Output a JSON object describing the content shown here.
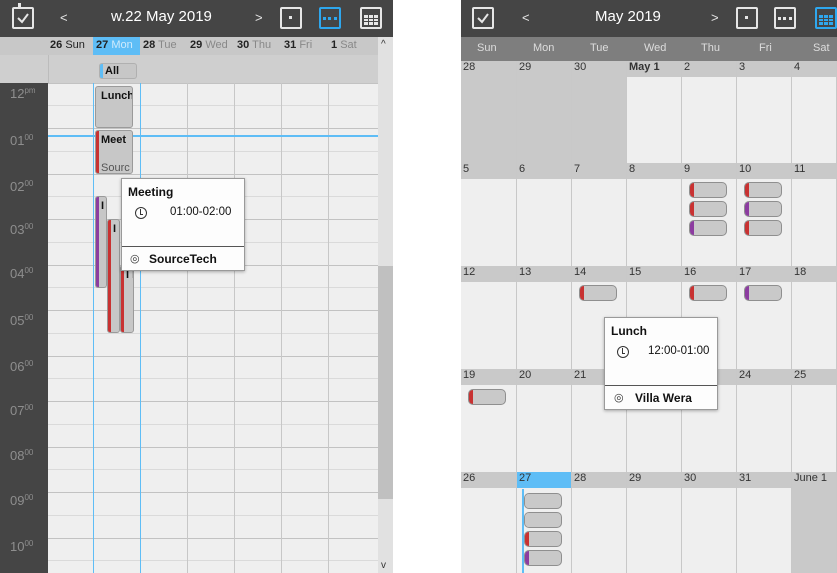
{
  "week_view": {
    "title": "w.22 May 2019",
    "prev": "<",
    "next": ">",
    "days": [
      {
        "num": "26",
        "name": "Sun"
      },
      {
        "num": "27",
        "name": "Mon"
      },
      {
        "num": "28",
        "name": "Tue"
      },
      {
        "num": "29",
        "name": "Wed"
      },
      {
        "num": "30",
        "name": "Thu"
      },
      {
        "num": "31",
        "name": "Fri"
      },
      {
        "num": "1",
        "name": "Sat"
      }
    ],
    "allday_label": "All",
    "times": [
      "12pm",
      "01",
      "02",
      "03",
      "04",
      "05",
      "06",
      "07",
      "08",
      "09",
      "10"
    ],
    "time_suffix": "00",
    "time_pm": "pm",
    "events": {
      "lunch": "Lunch",
      "meeting": "Meet",
      "source": "Sourc",
      "short1": "I",
      "short2": "I ,",
      "short3": "I I"
    },
    "popup": {
      "title": "Meeting",
      "time": "01:00-02:00",
      "location": "SourceTech"
    },
    "colors": {
      "red": "#c83232",
      "purple": "#8c3ca0",
      "blue": "#5ebdf6"
    }
  },
  "month_view": {
    "title": "May 2019",
    "prev": "<",
    "next": ">",
    "weekdays": [
      "Sun",
      "Mon",
      "Tue",
      "Wed",
      "Thu",
      "Fri",
      "Sat"
    ],
    "weeks": [
      [
        "28",
        "29",
        "30",
        "May 1",
        "2",
        "3",
        "4"
      ],
      [
        "5",
        "6",
        "7",
        "8",
        "9",
        "10",
        "11"
      ],
      [
        "12",
        "13",
        "14",
        "15",
        "16",
        "17",
        "18"
      ],
      [
        "19",
        "20",
        "21",
        "",
        "",
        "24",
        "25"
      ],
      [
        "26",
        "27",
        "28",
        "29",
        "30",
        "31",
        "June 1"
      ]
    ],
    "popup": {
      "title": "Lunch",
      "time": "12:00-01:00",
      "location": "Villa Wera"
    }
  }
}
